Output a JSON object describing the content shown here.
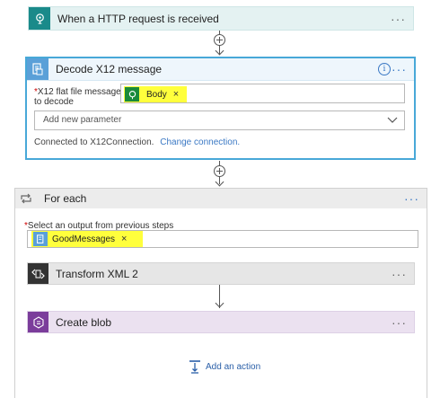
{
  "steps": {
    "http_trigger": {
      "title": "When a HTTP request is received"
    },
    "decode": {
      "title": "Decode X12 message",
      "field_label_line1": "X12 flat file message",
      "field_label_line2": "to decode",
      "token_label": "Body",
      "new_param_placeholder": "Add new parameter",
      "connected_text": "Connected to X12Connection.",
      "change_connection": "Change connection."
    },
    "foreach": {
      "title": "For each",
      "output_label": "Select an output from previous steps",
      "token_label": "GoodMessages",
      "add_action": "Add an action"
    },
    "transform": {
      "title": "Transform XML 2"
    },
    "create_blob": {
      "title": "Create blob"
    }
  },
  "common": {
    "more": "···",
    "remove": "×",
    "required_mark": "*"
  },
  "colors": {
    "trigger_teal": "#1a8a8a",
    "decode_border": "#48a8d8",
    "x12_blue": "#5aa0d8",
    "highlight": "#ffff3c",
    "link_blue": "#3a78c4",
    "transform_dark": "#333333",
    "blob_purple": "#7b3d9b"
  },
  "icons": [
    "http-request-icon",
    "decode-file-icon",
    "info-icon",
    "loop-icon",
    "transform-xml-icon",
    "blob-storage-icon",
    "add-action-icon",
    "chevron-down-icon"
  ]
}
